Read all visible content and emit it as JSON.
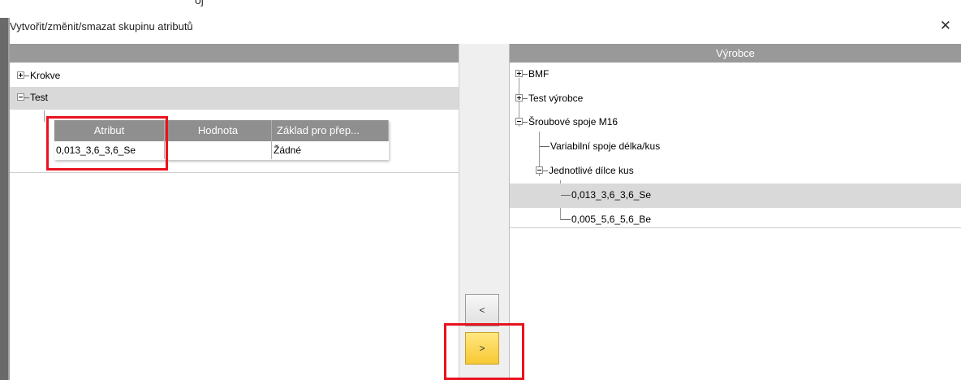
{
  "dialog": {
    "title": "Vytvořit/změnit/smazat skupinu atributů",
    "close_glyph": "✕"
  },
  "top_partial_text": "ој",
  "left_tree": {
    "items": [
      {
        "label": "Krokve",
        "expanded": false
      },
      {
        "label": "Test",
        "expanded": true
      }
    ],
    "grid": {
      "headers": [
        "Atribut",
        "Hodnota",
        "Základ pro přep..."
      ],
      "row": [
        "0,013_3,6_3,6_Se",
        "",
        "Žádné"
      ]
    }
  },
  "transfer_buttons": {
    "back_label": "<",
    "forward_label": ">"
  },
  "right_tree": {
    "header": "Výrobce",
    "items": [
      {
        "label": "BMF",
        "expanded": false
      },
      {
        "label": "Test výrobce",
        "expanded": false
      },
      {
        "label": "Šroubové spoje M16",
        "expanded": true
      },
      {
        "label": "Variabilní spoje délka/kus"
      },
      {
        "label": "Jednotlivé dílce kus",
        "expanded": true
      },
      {
        "label": "0,013_3,6_3,6_Se",
        "selected": true
      },
      {
        "label": "0,005_5,6_5,6_Be"
      }
    ]
  },
  "colors": {
    "header_gray": "#999999",
    "selection_gray": "#d9d9d9",
    "highlight_red": "#e8131e",
    "forward_button_yellow": "#f7c833"
  }
}
